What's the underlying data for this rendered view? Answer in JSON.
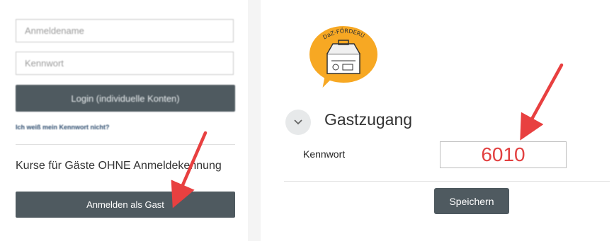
{
  "login_panel": {
    "username_placeholder": "Anmeldename",
    "password_placeholder": "Kennwort",
    "login_button": "Login (individuelle Konten)",
    "forgot_link": "Ich weiß mein Kennwort nicht?",
    "guest_heading": "Kurse für Gäste OHNE Anmeldekennung",
    "guest_button": "Anmelden als Gast"
  },
  "guest_panel": {
    "logo_text": "DaZ-FÖRDERUNG konkret",
    "section_title": "Gastzugang",
    "password_label": "Kennwort",
    "password_value": "6010",
    "save_button": "Speichern"
  },
  "colors": {
    "button_bg": "#4f5a60",
    "annotation_arrow": "#e84040",
    "password_text": "#e24040",
    "logo_bubble": "#f7a823"
  },
  "icons": {
    "chevron": "chevron-down-icon",
    "arrow": "annotation-arrow"
  }
}
